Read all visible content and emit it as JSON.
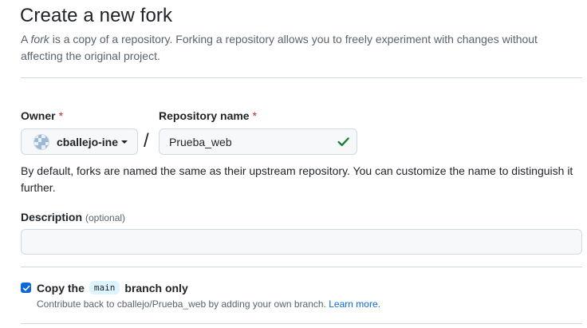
{
  "header": {
    "title": "Create a new fork",
    "subtitle_prefix": "A ",
    "subtitle_em": "fork",
    "subtitle_rest": " is a copy of a repository. Forking a repository allows you to freely experiment with changes without affecting the original project."
  },
  "owner": {
    "label": "Owner",
    "required_mark": "*",
    "value": "cballejo-ine"
  },
  "repository": {
    "label": "Repository name",
    "required_mark": "*",
    "value": "Prueba_web",
    "valid_icon": "check-icon"
  },
  "separator": "/",
  "naming_hint": "By default, forks are named the same as their upstream repository. You can customize the name to distinguish it further.",
  "description": {
    "label": "Description",
    "optional": "(optional)",
    "value": ""
  },
  "copy_branch": {
    "checked": true,
    "label_before": "Copy the",
    "branch": "main",
    "label_after": "branch only",
    "note": "Contribute back to cballejo/Prueba_web by adding your own branch.",
    "link": "Learn more."
  },
  "colors": {
    "accent": "#0969da",
    "success": "#1a7f37",
    "danger": "#d1242f"
  }
}
